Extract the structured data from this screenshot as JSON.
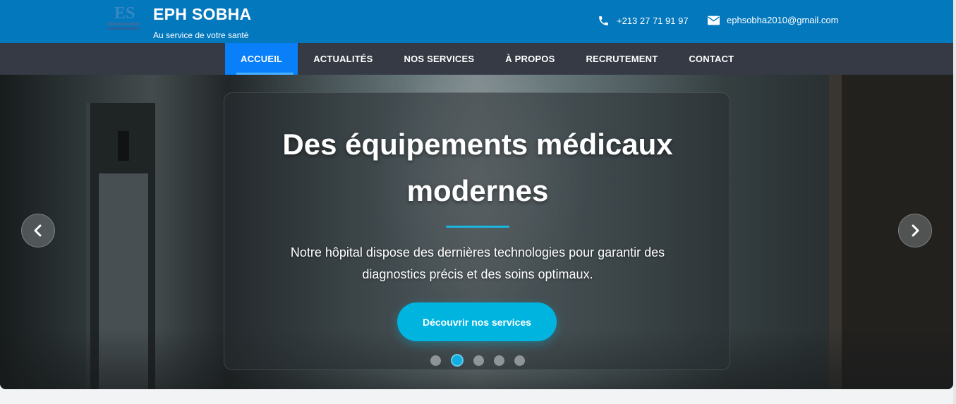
{
  "header": {
    "title": "EPH SOBHA",
    "subtitle": "Au service de votre santé",
    "logo_text": "ES",
    "phone": "+213 27 71 91 97",
    "email": "ephsobha2010@gmail.com"
  },
  "nav": {
    "items": [
      {
        "label": "ACCUEIL",
        "active": true
      },
      {
        "label": "ACTUALITÉS"
      },
      {
        "label": "NOS SERVICES"
      },
      {
        "label": "À PROPOS"
      },
      {
        "label": "RECRUTEMENT"
      },
      {
        "label": "CONTACT"
      }
    ]
  },
  "hero": {
    "title": "Des équipements médicaux modernes",
    "text": "Notre hôpital dispose des dernières technologies pour garantir des diagnostics précis et des soins optimaux.",
    "button_label": "Découvrir nos services",
    "slide_count": 5,
    "active_slide": 2
  },
  "colors": {
    "topbar": "#0378bd",
    "nav": "#353a45",
    "nav_active": "#0a7ffa",
    "accent": "#00b4e0"
  },
  "icons": [
    "phone-icon",
    "envelope-icon",
    "chevron-left-icon",
    "chevron-right-icon"
  ]
}
